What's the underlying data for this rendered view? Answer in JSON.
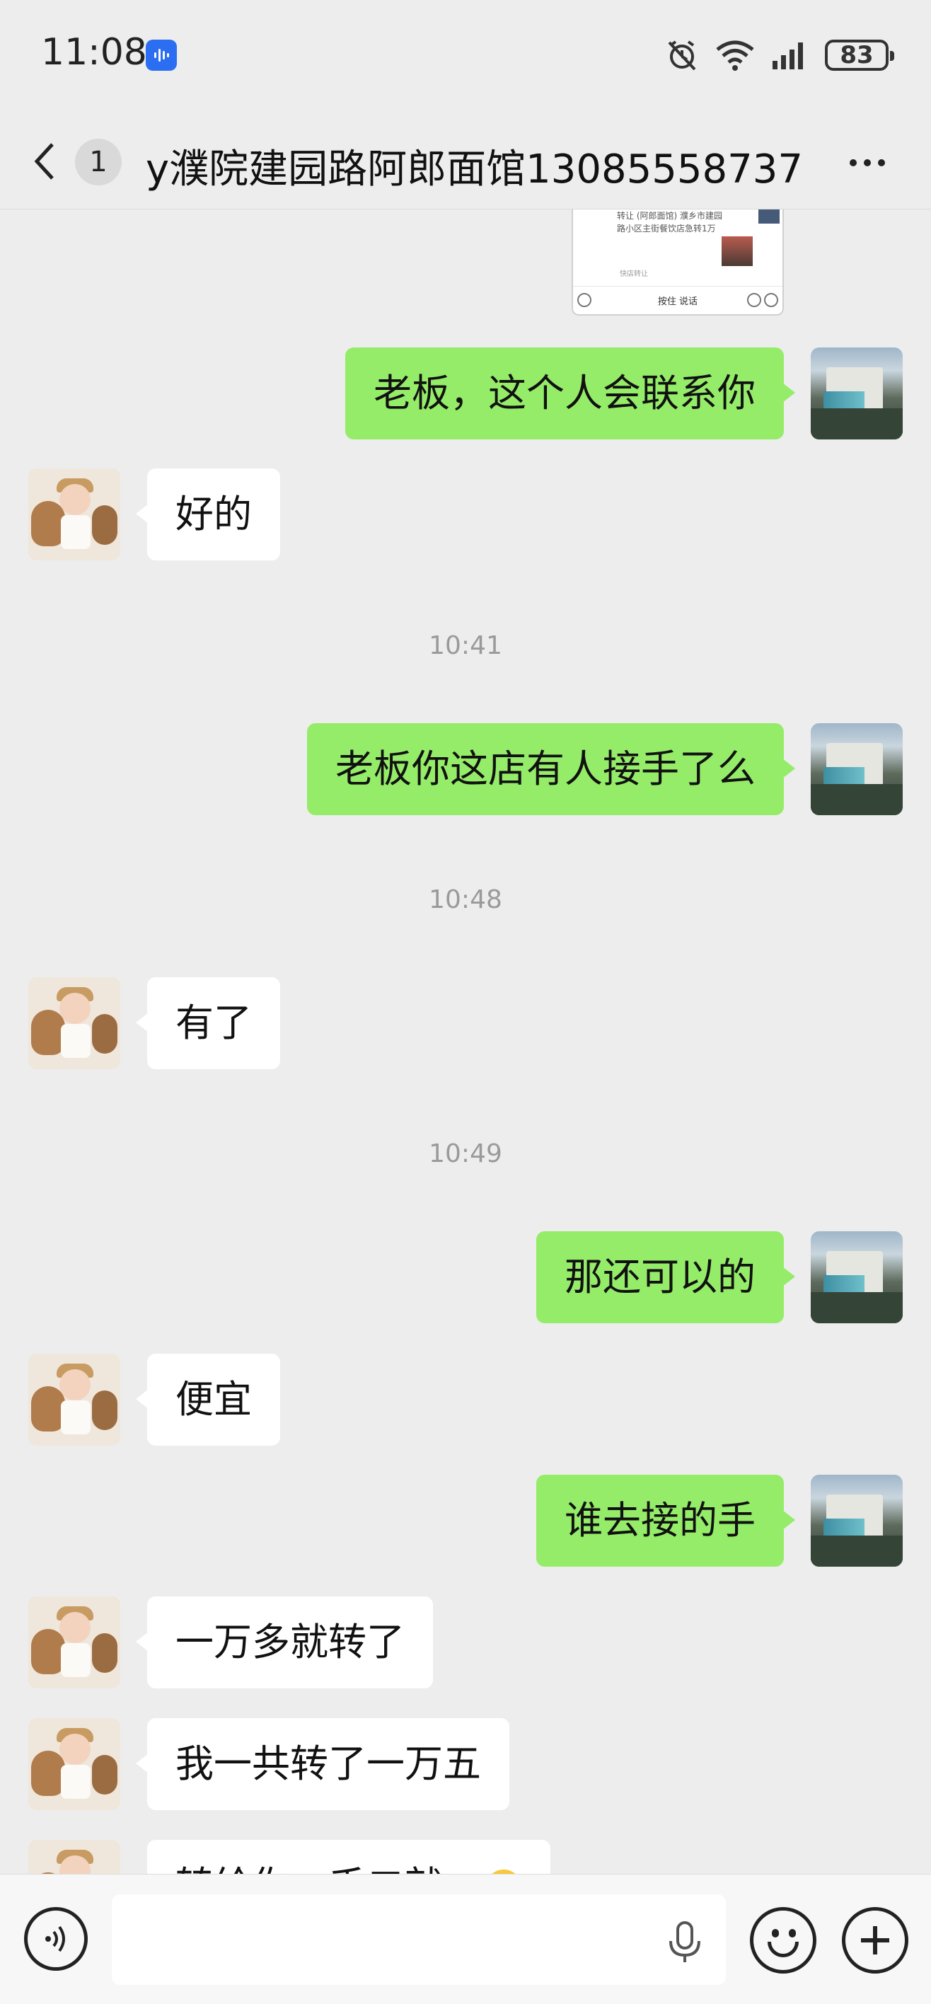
{
  "status_bar": {
    "time": "11:08",
    "battery": "83",
    "icons": [
      "voice-assistant-icon",
      "alarm-icon",
      "wifi-icon",
      "signal-icon",
      "battery-icon"
    ]
  },
  "header": {
    "unread_count": "1",
    "title": "y濮院建园路阿郎面馆13085558737"
  },
  "card_preview": {
    "text": "转让 (阿郎面馆) 濮乡市建园路小区主街餐饮店急转1万",
    "source": "快店转让",
    "bar_label": "按住 说话"
  },
  "messages": [
    {
      "type": "text",
      "sender": "me",
      "text": "老板，这个人会联系你"
    },
    {
      "type": "text",
      "sender": "them",
      "text": "好的"
    },
    {
      "type": "time",
      "text": "10:41"
    },
    {
      "type": "text",
      "sender": "me",
      "text": "老板你这店有人接手了么"
    },
    {
      "type": "time",
      "text": "10:48"
    },
    {
      "type": "text",
      "sender": "them",
      "text": "有了"
    },
    {
      "type": "time",
      "text": "10:49"
    },
    {
      "type": "text",
      "sender": "me",
      "text": "那还可以的"
    },
    {
      "type": "text",
      "sender": "them",
      "text": "便宜"
    },
    {
      "type": "text",
      "sender": "me",
      "text": "谁去接的手"
    },
    {
      "type": "text",
      "sender": "them",
      "text": "一万多就转了"
    },
    {
      "type": "text",
      "sender": "them",
      "text": "我一共转了一万五"
    },
    {
      "type": "text",
      "sender": "them",
      "text": "转给你一千二就..."
    }
  ],
  "input_bar": {
    "placeholder": "",
    "icons": [
      "voice-toggle-icon",
      "microphone-icon",
      "emoji-icon",
      "plus-icon"
    ]
  },
  "colors": {
    "background": "#ededed",
    "my_bubble": "#95ec69",
    "their_bubble": "#ffffff",
    "accent_blue": "#2b6ef2"
  }
}
